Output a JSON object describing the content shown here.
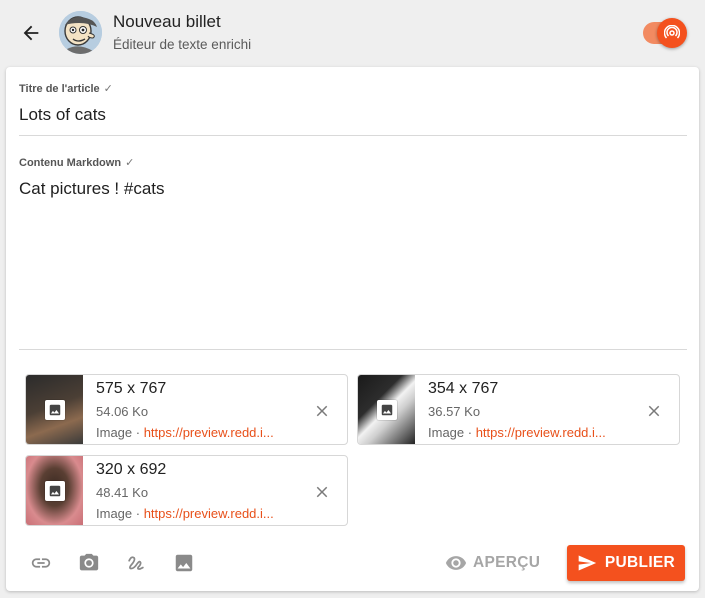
{
  "header": {
    "title": "Nouveau billet",
    "subtitle": "Éditeur de texte enrichi",
    "accent_color": "#f4511e"
  },
  "form": {
    "title_label": "Titre de l'article",
    "title_value": "Lots of cats",
    "content_label": "Contenu Markdown",
    "content_value": "Cat pictures ! #cats"
  },
  "attachments": [
    {
      "dims": "575 x 767",
      "size": "54.06 Ko",
      "type": "Image · ",
      "url": "https://preview.redd.i..."
    },
    {
      "dims": "354 x 767",
      "size": "36.57 Ko",
      "type": "Image · ",
      "url": "https://preview.redd.i..."
    },
    {
      "dims": "320 x 692",
      "size": "48.41 Ko",
      "type": "Image · ",
      "url": "https://preview.redd.i..."
    }
  ],
  "toolbar": {
    "icons": [
      "link-icon",
      "camera-icon",
      "draw-icon",
      "image-icon"
    ],
    "preview_label": "APERÇU",
    "publish_label": "PUBLIER"
  }
}
